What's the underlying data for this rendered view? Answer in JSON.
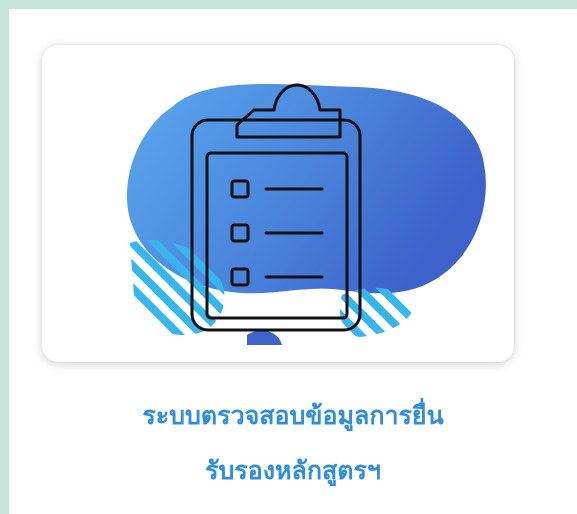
{
  "menu_tile": {
    "icon": "clipboard-checklist-icon",
    "caption_line_1": "ระบบตรวจสอบข้อมูลการยื่น",
    "caption_line_2": "รับรองหลักสูตรฯ"
  },
  "colors": {
    "page_border": "#c6e4da",
    "caption_text": "#2f8de0",
    "blob_blue_light": "#5aa8ee",
    "blob_blue_dark": "#3d62cc",
    "stripe_cyan": "#37b6ee",
    "icon_stroke": "#111111"
  }
}
